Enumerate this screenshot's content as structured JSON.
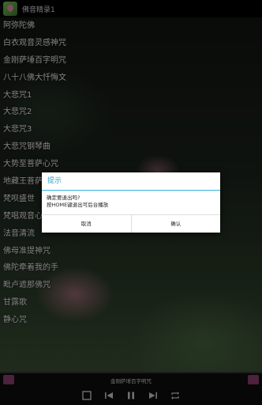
{
  "app": {
    "title": "佛音精录1"
  },
  "songs": [
    "阿弥陀佛",
    "白衣观音灵感神咒",
    "金刚萨埵百字明咒",
    "八十八佛大忏悔文",
    "大悲咒1",
    "大悲咒2",
    "大悲咒3",
    "大悲咒钢琴曲",
    "大势至菩萨心咒",
    "地藏王菩萨",
    "梵呗盛世",
    "梵唱观音心",
    "法音清流",
    "佛母准提神咒",
    "佛陀牵着我的手",
    "毗卢遮那佛咒",
    "甘露歌",
    "静心咒"
  ],
  "dialog": {
    "title": "提示",
    "line1": "确定要退出吗?",
    "line2": "按HOME键退出可后台播放",
    "cancel": "取消",
    "confirm": "确认"
  },
  "player": {
    "now_playing": "金刚萨埵百字明咒"
  }
}
